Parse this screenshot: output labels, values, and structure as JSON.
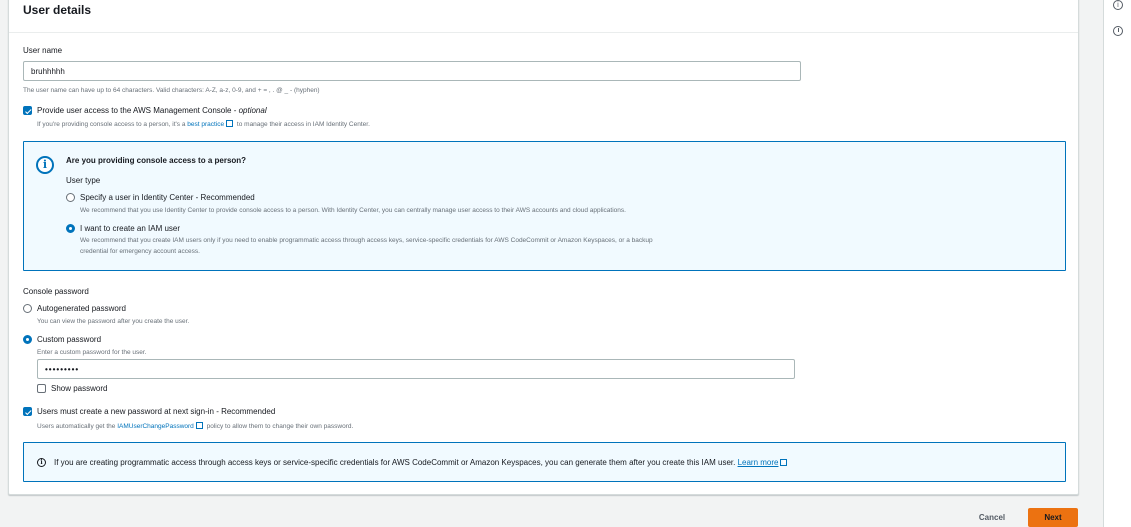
{
  "panel": {
    "title": "User details"
  },
  "username": {
    "label": "User name",
    "value": "bruhhhhh",
    "hint": "The user name can have up to 64 characters. Valid characters: A-Z, a-z, 0-9, and + = , . @ _ - (hyphen)"
  },
  "console_access": {
    "checked": true,
    "label": "Provide user access to the AWS Management Console - ",
    "optional": "optional",
    "hint_prefix": "If you're providing console access to a person, it's a ",
    "hint_link": "best practice",
    "hint_suffix": " to manage their access in IAM Identity Center."
  },
  "person_box": {
    "title": "Are you providing console access to a person?",
    "user_type_label": "User type",
    "options": [
      {
        "label": "Specify a user in Identity Center - Recommended",
        "desc": "We recommend that you use Identity Center to provide console access to a person. With Identity Center, you can centrally manage user access to their AWS accounts and cloud applications.",
        "selected": false
      },
      {
        "label": "I want to create an IAM user",
        "desc_line1": "We recommend that you create IAM users only if you need to enable programmatic access through access keys, service-specific credentials for AWS CodeCommit or Amazon Keyspaces, or a backup",
        "desc_line2": "credential for emergency account access.",
        "selected": true
      }
    ]
  },
  "console_password": {
    "label": "Console password",
    "options": [
      {
        "label": "Autogenerated password",
        "desc": "You can view the password after you create the user.",
        "selected": false
      },
      {
        "label": "Custom password",
        "desc": "Enter a custom password for the user.",
        "selected": true
      }
    ],
    "password_value": "•••••••••",
    "show_password_label": "Show password"
  },
  "reset_required": {
    "checked": true,
    "label": "Users must create a new password at next sign-in - Recommended",
    "hint_prefix": "Users automatically get the ",
    "hint_link": "IAMUserChangePassword",
    "hint_suffix": " policy to allow them to change their own password."
  },
  "programmatic_info": {
    "text": "If you are creating programmatic access through access keys or service-specific credentials for AWS CodeCommit or Amazon Keyspaces, you can generate them after you create this IAM user. ",
    "link": "Learn more"
  },
  "footer": {
    "cancel": "Cancel",
    "next": "Next"
  },
  "colors": {
    "accent": "#0073bb",
    "primary_button": "#ec7211",
    "info_bg": "#f1faff"
  },
  "icons": [
    "info-icon",
    "external-link-icon",
    "clock-icon"
  ]
}
